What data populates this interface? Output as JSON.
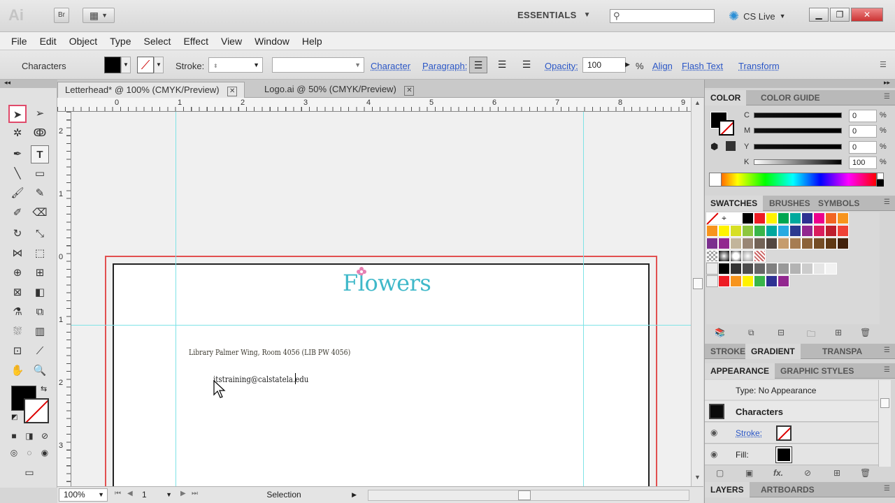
{
  "app": {
    "logo": "Ai",
    "bridge_label": "Br",
    "workspace": "ESSENTIALS",
    "cs_live": "CS Live"
  },
  "menu": [
    "File",
    "Edit",
    "Object",
    "Type",
    "Select",
    "Effect",
    "View",
    "Window",
    "Help"
  ],
  "control": {
    "selection_type": "Characters",
    "stroke_label": "Stroke:",
    "character_link": "Character",
    "paragraph_link": "Paragraph:",
    "opacity_label": "Opacity:",
    "opacity_value": "100",
    "opacity_unit": "%",
    "align_link": "Align",
    "flash_text_link": "Flash Text",
    "transform_link": "Transform"
  },
  "tabs": [
    {
      "label": "Letterhead* @ 100% (CMYK/Preview)",
      "active": true
    },
    {
      "label": "Logo.ai @ 50% (CMYK/Preview)",
      "active": false
    }
  ],
  "ruler": {
    "h": [
      "0",
      "1",
      "2",
      "3",
      "4",
      "5",
      "6",
      "7",
      "8",
      "9"
    ],
    "v": [
      "2",
      "1",
      "0",
      "1",
      "2",
      "3"
    ]
  },
  "document": {
    "logo_text": "Flowers",
    "address": "Library Palmer Wing, Room 4056 (LIB PW 4056)",
    "email": "itstraining@calstatela.edu"
  },
  "status": {
    "zoom": "100%",
    "artboard": "1",
    "tool": "Selection"
  },
  "color_panel": {
    "tabs": [
      "COLOR",
      "COLOR GUIDE"
    ],
    "channels": [
      {
        "label": "C",
        "value": "0"
      },
      {
        "label": "M",
        "value": "0"
      },
      {
        "label": "Y",
        "value": "0"
      },
      {
        "label": "K",
        "value": "100"
      }
    ],
    "unit": "%"
  },
  "swatches_panel": {
    "tabs": [
      "SWATCHES",
      "BRUSHES",
      "SYMBOLS"
    ],
    "row1": [
      "#ffffff",
      "#000000",
      "#ed1c24",
      "#fff200",
      "#00a651",
      "#00a99d",
      "#2e3192",
      "#ec008c",
      "#f26522",
      "#f7941d",
      "#ef4136",
      "#d91b5c"
    ],
    "row2": [
      "#f7941d",
      "#fff200",
      "#d7df23",
      "#8dc63f",
      "#39b54a",
      "#00a79d",
      "#27aae1",
      "#2b3990",
      "#92278f",
      "#da1c5c",
      "#be1e2d",
      "#ef4136"
    ],
    "row3": [
      "#7b2f8e",
      "#92278f",
      "#c2b59b",
      "#998675",
      "#736357",
      "#534741",
      "#c69c6d",
      "#a67c52",
      "#8c6239",
      "#754c24",
      "#603813",
      "#42210b"
    ],
    "row5": [
      "#000000",
      "#333333",
      "#4d4d4d",
      "#666666",
      "#808080",
      "#999999",
      "#b3b3b3",
      "#cccccc",
      "#e6e6e6",
      "#f2f2f2"
    ],
    "row6": [
      "#ed1c24",
      "#f7941d",
      "#fff200",
      "#39b54a",
      "#2e3192",
      "#92278f"
    ]
  },
  "gradient_panel": {
    "tabs": [
      "STROKE",
      "GRADIENT",
      "TRANSPA"
    ]
  },
  "appearance_panel": {
    "tabs": [
      "APPEARANCE",
      "GRAPHIC STYLES"
    ],
    "type_text": "Type: No Appearance",
    "object_name": "Characters",
    "stroke_label": "Stroke:",
    "fill_label": "Fill:"
  },
  "layers_panel": {
    "tabs": [
      "LAYERS",
      "ARTBOARDS"
    ]
  },
  "colors": {
    "guide": "#7fe3e6",
    "bleed": "#e25050",
    "logo": "#3fb8c9",
    "link": "#2a56c6"
  }
}
